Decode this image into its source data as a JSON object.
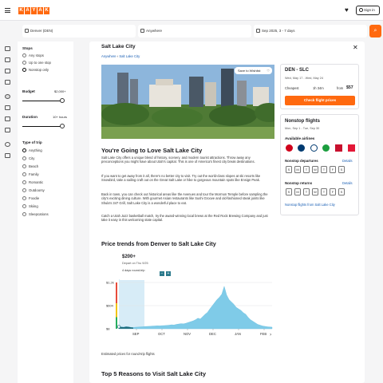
{
  "header": {
    "logo_letters": [
      "K",
      "A",
      "Y",
      "A",
      "K"
    ],
    "signin_label": "Sign in",
    "brand_color": "#ff690f"
  },
  "search": {
    "origin": "Denver (DEN)",
    "destination": "Anywhere",
    "dates": "Sep 2025, 3 - 7 days"
  },
  "filters": {
    "stops_title": "Stops",
    "stops": [
      "Any stops",
      "Up to one stop",
      "Nonstop only"
    ],
    "stops_selected": 2,
    "budget_title": "Budget",
    "budget_value": "$2,000+",
    "duration_title": "Duration",
    "duration_value": "10+ hours",
    "trip_title": "Type of trip",
    "trip_types": [
      "Anything",
      "City",
      "Beach",
      "Family",
      "Romantic",
      "Outdoorsy",
      "Foodie",
      "Skiing",
      "Sleepcations"
    ],
    "trip_selected": 0
  },
  "main": {
    "title": "Salt Lake City",
    "breadcrumb": [
      "Anywhere",
      "Salt Lake City"
    ],
    "save_label": "Save to Wishlist",
    "headline_prefix": "You're Going to Love ",
    "headline_city": "Salt Lake City",
    "paragraphs": [
      "Salt Lake City offers a unique blend of history, scenery, and modern tourist attractions. Throw away any preconceptions you might have about Utah's capital. This is one of America's finest city break destinations.",
      "If you want to get away from it all, there's no better city to visit. Try out the world-class slopes at ski resorts like Snowbird, take a sailing craft out on the Great Salt Lake or hike to gorgeous mountain spots like Ensign Peak.",
      "Back in town, you can check out historical areas like the Avenues and tour the Mormon Temple before sampling the city's exciting dining culture. With gourmet Asian restaurants like Sushi Groove and old-fashioned steak joints like Shula's 347 Grill, Salt Lake City is a wonderful place to eat.",
      "Catch a Utah Jazz basketball match, try the award-winning local brews at the Red Rock Brewing Company and just take it easy in this welcoming state capital."
    ],
    "trends_title": "Price trends from Denver to Salt Lake City",
    "trends_price": "$200+",
    "trends_depart": "Depart on Thu 9/25",
    "trends_trip": "4 days round-trip",
    "trends_caption": "Estimated prices for round-trip flights",
    "reasons_prefix": "Top 5 Reasons to Visit ",
    "reasons_city": "Salt Lake City"
  },
  "flight_card": {
    "route": "DEN - SLC",
    "dates": "Wed, May 17 - Wed, May 24",
    "cheapest_label": "Cheapest",
    "duration": "1h 34m",
    "from_label": "from",
    "price": "$57",
    "cta": "Check flight prices"
  },
  "nonstop_card": {
    "title": "Nonstop flights",
    "dates": "Mon, Sep 1 - Tue, Sep 30",
    "airlines_title": "Available airlines",
    "departures_title": "Nonstop departures",
    "returns_title": "Nonstop returns",
    "details_label": "Details",
    "days": [
      "S",
      "M",
      "T",
      "W",
      "T",
      "F",
      "S"
    ],
    "link": "Nonstop flights from Salt Lake City"
  },
  "chart_data": {
    "type": "area",
    "x_ticks": [
      "SEP",
      "OCT",
      "NOV",
      "DEC",
      "JAN",
      "FEB"
    ],
    "y_ticks": [
      "$1.2k",
      "$604",
      "$8"
    ],
    "ylim": [
      8,
      1200
    ],
    "series": [
      {
        "values": [
          60,
          55,
          50,
          62,
          58,
          45,
          40,
          48,
          52,
          58,
          60,
          66,
          70,
          72,
          78,
          80,
          85,
          82,
          88,
          90,
          95,
          100,
          110,
          105,
          120,
          130,
          140,
          135,
          150,
          170,
          190,
          210,
          240,
          280,
          260,
          320,
          380,
          430,
          520,
          600,
          680,
          760,
          820,
          900,
          1100,
          880,
          760,
          700,
          640,
          560,
          520,
          480,
          420,
          380,
          300,
          240,
          200,
          160,
          120,
          100,
          80,
          70,
          60,
          55,
          50
        ]
      }
    ]
  }
}
